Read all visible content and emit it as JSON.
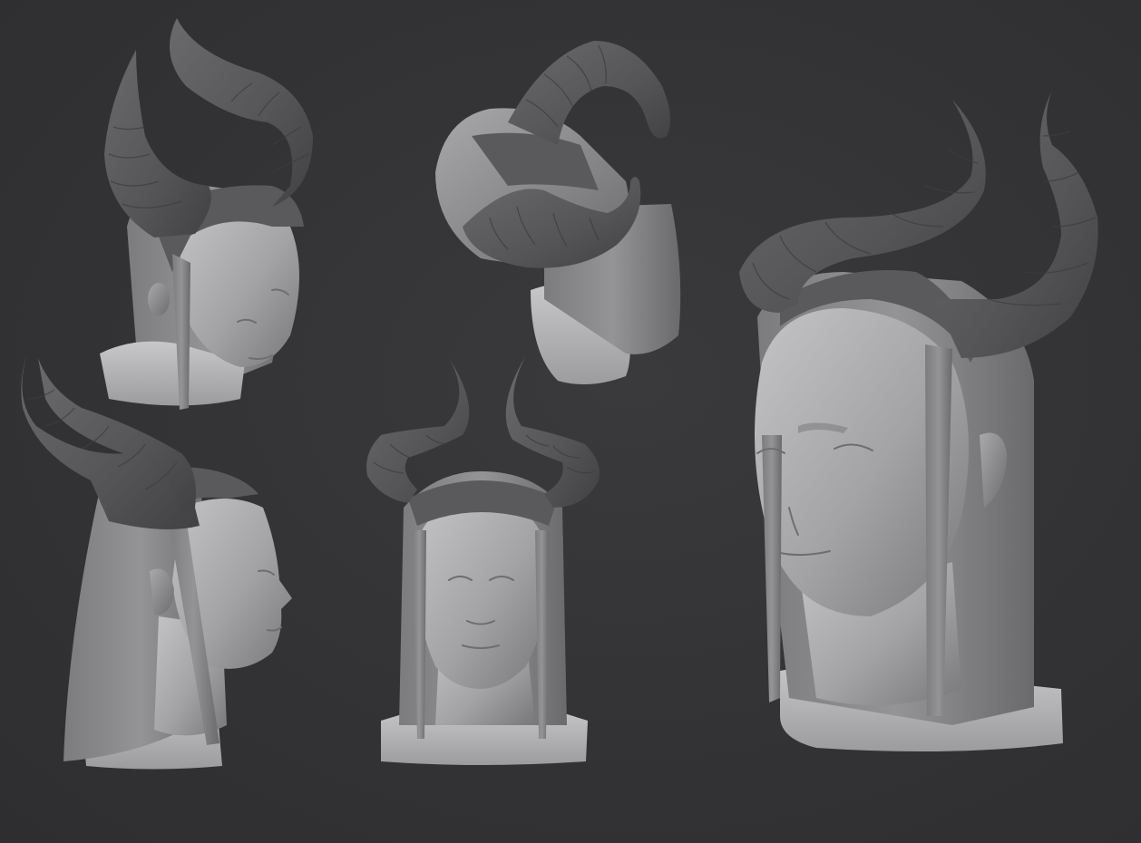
{
  "scene": {
    "background_color": "#333335",
    "material_color": "#9a9a9c",
    "views": [
      {
        "name": "three-quarter-top-view"
      },
      {
        "name": "top-view"
      },
      {
        "name": "three-quarter-front-view"
      },
      {
        "name": "side-profile-view"
      },
      {
        "name": "front-view"
      }
    ]
  }
}
